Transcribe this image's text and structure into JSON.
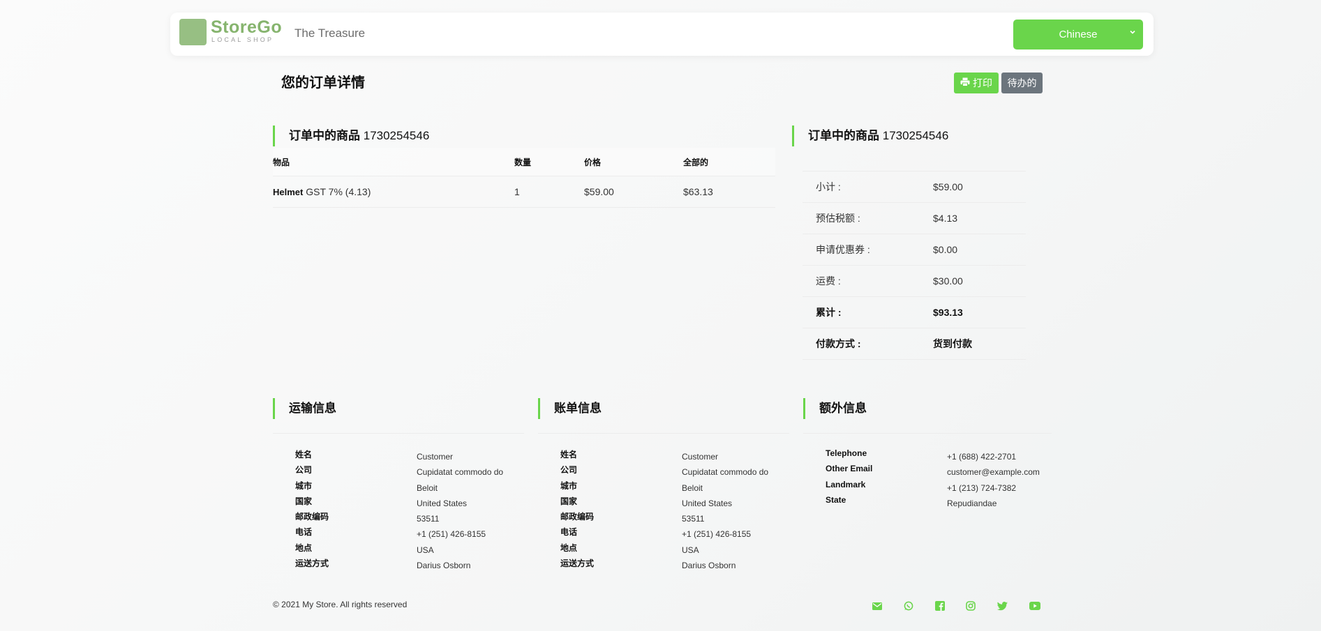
{
  "header": {
    "logo_text": "StoreGo",
    "logo_sub": "LOCAL SHOP",
    "store_name": "The Treasure",
    "language": "Chinese"
  },
  "page": {
    "title": "您的订单详情",
    "print_label": "打印",
    "status_label": "待办的"
  },
  "order": {
    "section_title": "订单中的商品",
    "order_number": "1730254546",
    "columns": [
      "物品",
      "数量",
      "价格",
      "全部的"
    ],
    "items": [
      {
        "name": "Helmet",
        "tax": "GST 7% (4.13)",
        "qty": "1",
        "price": "$59.00",
        "total": "$63.13"
      }
    ]
  },
  "summary": {
    "section_title": "订单中的商品",
    "order_number": "1730254546",
    "rows": [
      {
        "label": "小计 :",
        "value": "$59.00"
      },
      {
        "label": "预估税额 :",
        "value": "$4.13"
      },
      {
        "label": "申请优惠券 :",
        "value": "$0.00"
      },
      {
        "label": "运费 :",
        "value": "$30.00"
      },
      {
        "label": "累计 :",
        "value": "$93.13"
      },
      {
        "label": "付款方式 :",
        "value": "货到付款"
      }
    ]
  },
  "shipping": {
    "title": "运输信息",
    "labels": [
      "姓名",
      "公司",
      "城市",
      "国家",
      "邮政编码",
      "电话",
      "地点",
      "运送方式"
    ],
    "values": [
      "Customer",
      "Cupidatat commodo do",
      "Beloit",
      "United States",
      "53511",
      "+1 (251) 426-8155",
      "USA",
      "Darius Osborn"
    ]
  },
  "billing": {
    "title": "账单信息",
    "labels": [
      "姓名",
      "公司",
      "城市",
      "国家",
      "邮政编码",
      "电话",
      "地点",
      "运送方式"
    ],
    "values": [
      "Customer",
      "Cupidatat commodo do",
      "Beloit",
      "United States",
      "53511",
      "+1 (251) 426-8155",
      "USA",
      "Darius Osborn"
    ]
  },
  "extra": {
    "title": "额外信息",
    "labels": [
      "Telephone",
      "Other Email",
      "Landmark",
      "State"
    ],
    "values": [
      "+1 (688) 422-2701",
      "customer@example.com",
      "+1 (213) 724-7382",
      "Repudiandae"
    ]
  },
  "footer": {
    "copyright": "© 2021 My Store. All rights reserved",
    "social_icons": [
      "envelope-icon",
      "whatsapp-icon",
      "facebook-icon",
      "instagram-icon",
      "twitter-icon",
      "youtube-icon"
    ]
  },
  "colors": {
    "accent": "#6ad54b",
    "secondary": "#6c757d",
    "logo": "#86b46e"
  }
}
